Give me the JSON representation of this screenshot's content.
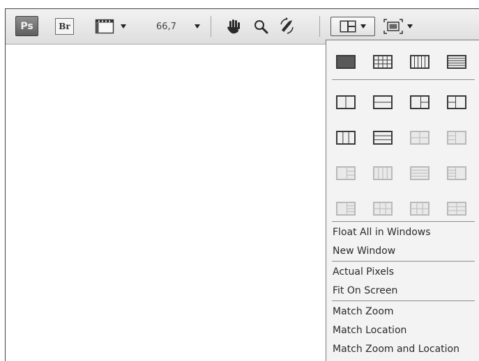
{
  "toolbar": {
    "app_badge": "Ps",
    "bridge_badge": "Br",
    "zoom_value": "66,7"
  },
  "arrange_panel": {
    "layout_rows": [
      [
        {
          "icon": "single-layout-icon",
          "enabled": true
        },
        {
          "icon": "grid-layout-icon",
          "enabled": true
        },
        {
          "icon": "columns-layout-icon",
          "enabled": true
        },
        {
          "icon": "rows-layout-icon",
          "enabled": true
        }
      ],
      [
        {
          "icon": "2-up-vertical-icon",
          "enabled": true
        },
        {
          "icon": "2-up-horizontal-icon",
          "enabled": true
        },
        {
          "icon": "3-up-left-icon",
          "enabled": true
        },
        {
          "icon": "3-up-right-icon",
          "enabled": true
        }
      ],
      [
        {
          "icon": "3-up-vertical-icon",
          "enabled": true
        },
        {
          "icon": "3-up-horizontal-icon",
          "enabled": true
        },
        {
          "icon": "4-up-grid-icon",
          "enabled": false
        },
        {
          "icon": "4-up-right-icon",
          "enabled": false
        }
      ],
      [
        {
          "icon": "4-up-left-icon",
          "enabled": false
        },
        {
          "icon": "4-up-vertical-icon",
          "enabled": false
        },
        {
          "icon": "4-up-horizontal-icon",
          "enabled": false
        },
        {
          "icon": "5-up-right-icon",
          "enabled": false
        }
      ],
      [
        {
          "icon": "5-up-left-icon",
          "enabled": false
        },
        {
          "icon": "6-up-grid-icon",
          "enabled": false
        },
        {
          "icon": "6-up-wide-icon",
          "enabled": false
        },
        {
          "icon": "6-up-mixed-icon",
          "enabled": false
        }
      ]
    ],
    "menu_items": {
      "float_all": "Float All in Windows",
      "new_window": "New Window",
      "actual_pixels": "Actual Pixels",
      "fit_on_screen": "Fit On Screen",
      "match_zoom": "Match Zoom",
      "match_location": "Match Location",
      "match_zoom_location": "Match Zoom and Location"
    }
  },
  "colors": {
    "enabled_icon": "#3a3a3a",
    "disabled_icon": "#b9b9b9",
    "panel_bg": "#f3f3f3"
  }
}
